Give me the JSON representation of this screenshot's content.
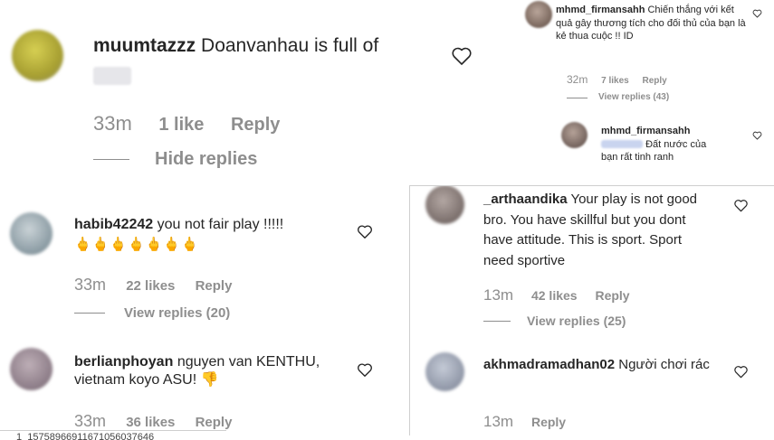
{
  "c1": {
    "username": "muumtazzz",
    "text": "Doanvanhau is full of",
    "time": "33m",
    "likes": "1 like",
    "reply": "Reply",
    "hide": "Hide replies"
  },
  "c2": {
    "username": "habib42242",
    "text": "you not fair play !!!!!",
    "emojis": "🖕🖕🖕🖕🖕🖕🖕",
    "time": "33m",
    "likes": "22 likes",
    "reply": "Reply",
    "view": "View replies (20)"
  },
  "c3": {
    "username": "berlianphoyan",
    "text": "nguyen van KENTHU, vietnam koyo ASU! 👎",
    "time": "33m",
    "likes": "36 likes",
    "reply": "Reply"
  },
  "c4": {
    "username": "mhmd_firmansahh",
    "text": "Chiến thắng với kết quả gây thương tích cho đối thủ của bạn là kẻ thua cuộc !! ID",
    "time": "32m",
    "likes": "7 likes",
    "reply": "Reply",
    "view": "View replies (43)"
  },
  "c5": {
    "username": "mhmd_firmansahh",
    "text": "Đất nước của bạn rất tinh ranh"
  },
  "c6": {
    "username": "_arthaandika",
    "text": "Your play is not good bro. You have skillful but you dont have attitude. This is sport. Sport need sportive",
    "time": "13m",
    "likes": "42 likes",
    "reply": "Reply",
    "view": "View replies (25)"
  },
  "c7": {
    "username": "akhmadramadhan02",
    "text": "Người chơi rác",
    "time": "13m",
    "reply": "Reply"
  },
  "footer": {
    "id_text": "1_15758966911671056037646"
  },
  "icons": {
    "like": "heart-outline-icon"
  }
}
